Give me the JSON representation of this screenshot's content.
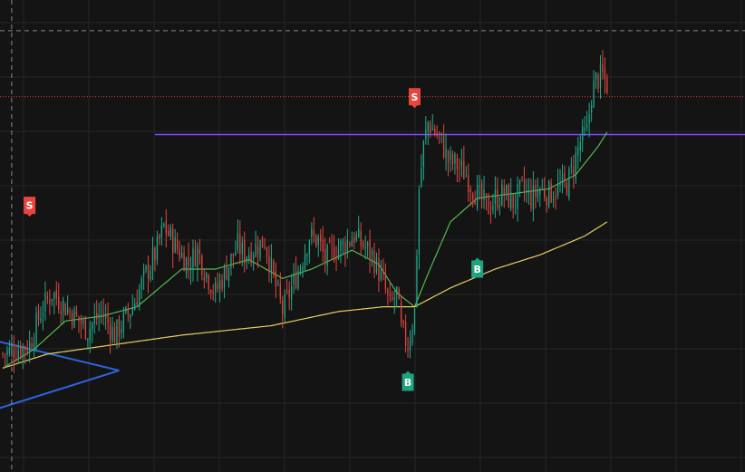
{
  "chart_data": {
    "type": "candlestick",
    "grid": true,
    "ylim": [
      0,
      100
    ],
    "colors": {
      "background": "#141414",
      "grid": "#262626",
      "candle_up": "#1fa98a",
      "candle_down": "#e0463f",
      "sma_fast": "#57b84e",
      "sma_slow": "#e8cf63",
      "horizontal_level": "#7c4dff",
      "price_line": "#d84a3b",
      "crosshair": "#8a8a8a",
      "trend_lines": "#2e63e0",
      "buy_marker": "#1ea47f",
      "sell_marker": "#e8463c"
    },
    "close_anchors": [
      [
        0,
        25
      ],
      [
        12,
        27
      ],
      [
        17,
        34
      ],
      [
        22,
        38
      ],
      [
        28,
        35
      ],
      [
        34,
        32
      ],
      [
        38,
        30
      ],
      [
        44,
        34
      ],
      [
        50,
        29
      ],
      [
        58,
        35
      ],
      [
        64,
        42
      ],
      [
        68,
        46
      ],
      [
        72,
        52
      ],
      [
        77,
        48
      ],
      [
        83,
        44
      ],
      [
        87,
        47
      ],
      [
        90,
        43
      ],
      [
        95,
        38
      ],
      [
        101,
        44
      ],
      [
        105,
        48
      ],
      [
        108,
        46
      ],
      [
        114,
        48
      ],
      [
        117,
        49
      ],
      [
        121,
        41
      ],
      [
        125,
        34
      ],
      [
        129,
        39
      ],
      [
        133,
        44
      ],
      [
        137,
        50
      ],
      [
        141,
        49
      ],
      [
        144,
        45
      ],
      [
        148,
        47
      ],
      [
        152,
        48
      ],
      [
        157,
        50
      ],
      [
        161,
        48
      ],
      [
        165,
        46
      ],
      [
        170,
        40
      ],
      [
        173,
        35
      ],
      [
        176,
        38
      ],
      [
        178,
        30
      ],
      [
        181,
        27
      ],
      [
        184,
        34
      ],
      [
        186,
        60
      ],
      [
        188,
        69
      ],
      [
        190,
        74
      ],
      [
        193,
        72
      ],
      [
        196,
        70
      ],
      [
        199,
        66
      ],
      [
        203,
        65
      ],
      [
        207,
        63
      ],
      [
        210,
        60
      ],
      [
        213,
        58
      ],
      [
        217,
        56
      ],
      [
        220,
        58
      ],
      [
        224,
        59
      ],
      [
        228,
        57
      ],
      [
        232,
        60
      ],
      [
        236,
        58
      ],
      [
        240,
        60
      ],
      [
        244,
        59
      ],
      [
        248,
        60
      ],
      [
        252,
        61
      ],
      [
        255,
        65
      ],
      [
        258,
        70
      ],
      [
        261,
        72
      ],
      [
        263,
        80
      ],
      [
        265,
        83
      ],
      [
        268,
        84
      ],
      [
        270,
        82
      ]
    ],
    "series": [
      {
        "values": [
          [
            0,
            22
          ],
          [
            14,
            26
          ],
          [
            28,
            32
          ],
          [
            44,
            33
          ],
          [
            60,
            35
          ],
          [
            80,
            43
          ],
          [
            95,
            43
          ],
          [
            110,
            45
          ],
          [
            125,
            41
          ],
          [
            138,
            43
          ],
          [
            156,
            47
          ],
          [
            168,
            44
          ],
          [
            176,
            38
          ],
          [
            184,
            35
          ],
          [
            190,
            42
          ],
          [
            200,
            53
          ],
          [
            212,
            58
          ],
          [
            228,
            59
          ],
          [
            244,
            60
          ],
          [
            256,
            63
          ],
          [
            266,
            69
          ],
          [
            270,
            72
          ]
        ]
      },
      {
        "values": [
          [
            0,
            22
          ],
          [
            20,
            25
          ],
          [
            50,
            27
          ],
          [
            80,
            29
          ],
          [
            120,
            31
          ],
          [
            150,
            34
          ],
          [
            170,
            35
          ],
          [
            184,
            35
          ],
          [
            200,
            39
          ],
          [
            220,
            43
          ],
          [
            240,
            46
          ],
          [
            260,
            50
          ],
          [
            270,
            53
          ]
        ]
      }
    ],
    "horizontal_level": 71.5,
    "last_price": 79.5,
    "crosshair_price": 93.5,
    "crosshair_bar": 4,
    "markers": [
      {
        "label": "S",
        "kind": "sell",
        "bar": 12,
        "value": 56.5
      },
      {
        "label": "B",
        "kind": "buy",
        "bar": 181,
        "value": 19
      },
      {
        "label": "B",
        "kind": "buy",
        "bar": 212,
        "value": 43
      },
      {
        "label": "S",
        "kind": "sell",
        "bar": 184,
        "value": 79.5
      }
    ],
    "trend_lines": [
      [
        [
          -5,
          28
        ],
        [
          52,
          21.5
        ]
      ],
      [
        [
          52,
          21.5
        ],
        [
          -5,
          13
        ]
      ]
    ]
  }
}
